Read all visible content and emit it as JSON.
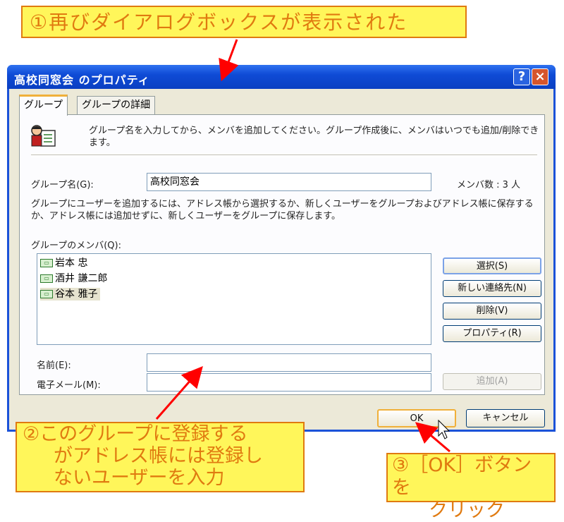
{
  "callouts": {
    "c1": "①再びダイアログボックスが表示された",
    "c2_l1": "②このグループに登録する",
    "c2_l2": "がアドレス帳には登録し",
    "c2_l3": "ないユーザーを入力",
    "c3_l1": "③［OK］ボタンを",
    "c3_l2": "クリック"
  },
  "dialog": {
    "title": "高校同窓会 のプロパティ",
    "help_glyph": "?",
    "close_glyph": "×",
    "tabs": [
      {
        "label": "グループ"
      },
      {
        "label": "グループの詳細"
      }
    ],
    "intro": "グループ名を入力してから、メンバを追加してください。グループ作成後に、メンバはいつでも追加/削除できます。",
    "group_name_label": "グループ名(G):",
    "group_name_value": "高校同窓会",
    "member_count": "メンバ数 : 3 人",
    "info": "グループにユーザーを追加するには、アドレス帳から選択するか、新しくユーザーをグループおよびアドレス帳に保存するか、アドレス帳には追加せずに、新しくユーザーをグループに保存します。",
    "members_label": "グループのメンバ(Q):",
    "members": [
      "岩本 忠",
      "酒井 謙二郎",
      "谷本 雅子"
    ],
    "buttons": {
      "select": "選択(S)",
      "new_contact": "新しい連絡先(N)",
      "delete": "削除(V)",
      "properties": "プロパティ(R)",
      "add": "追加(A)",
      "ok": "OK",
      "cancel": "キャンセル"
    },
    "name_label": "名前(E):",
    "email_label": "電子メール(M):"
  },
  "colors": {
    "callout_bg": "#fff65a",
    "callout_text": "#e07a10",
    "arrow": "#ff0000",
    "titlebar": "#0f4bd6"
  }
}
